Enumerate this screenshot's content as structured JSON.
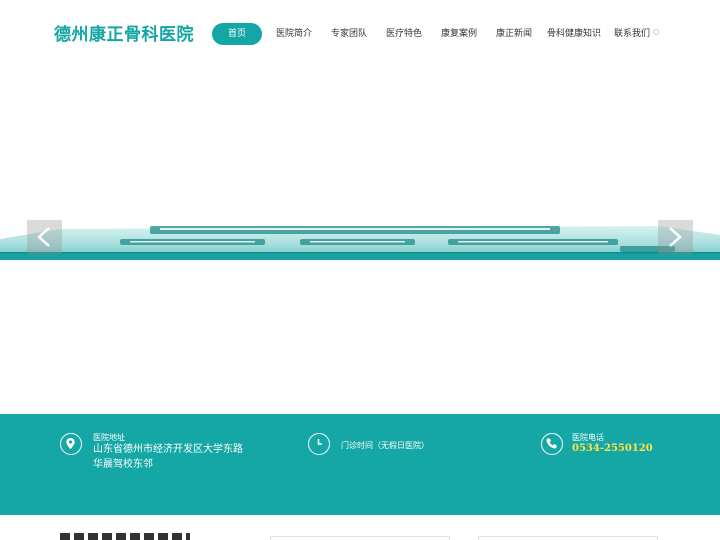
{
  "header": {
    "logo": "德州康正骨科医院",
    "nav": [
      {
        "label": "首页",
        "active": true
      },
      {
        "label": "医院简介",
        "active": false
      },
      {
        "label": "专家团队",
        "active": false
      },
      {
        "label": "医疗特色",
        "active": false
      },
      {
        "label": "康复案例",
        "active": false
      },
      {
        "label": "康正新闻",
        "active": false
      },
      {
        "label": "骨科健康知识",
        "active": false
      },
      {
        "label": "联系我们",
        "active": false
      }
    ]
  },
  "banner": {
    "prev_icon": "chevron-left-icon",
    "next_icon": "chevron-right-icon"
  },
  "info": {
    "address": {
      "icon": "location-pin-icon",
      "title": "医院地址",
      "line1": "山东省德州市经济开发区大学东路",
      "line2": "华晨驾校东邻"
    },
    "hours": {
      "icon": "clock-icon",
      "text": "门诊时间（无假日医院）"
    },
    "phone": {
      "icon": "phone-icon",
      "title": "医院电话",
      "number": "0534-2550120"
    }
  },
  "colors": {
    "brand": "#13a6a5",
    "phone_highlight": "#ffe14a"
  }
}
